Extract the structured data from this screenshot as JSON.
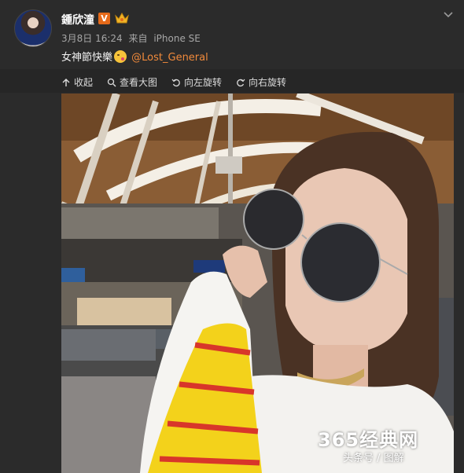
{
  "post": {
    "username": "鍾欣潼",
    "verified_badge": "V",
    "date": "3月8日 16:24",
    "source_prefix": "来自",
    "source": "iPhone SE",
    "text": "女神節快樂",
    "mention": "@Lost_General"
  },
  "toolbar": {
    "collapse": "收起",
    "view_large": "查看大图",
    "rotate_left": "向左旋转",
    "rotate_right": "向右旋转"
  },
  "watermark": {
    "main": "365经典网",
    "sub": "头条号 / 图解"
  },
  "colors": {
    "background": "#2b2b2b",
    "mention": "#f18a3b",
    "badge": "#e56a1a"
  }
}
